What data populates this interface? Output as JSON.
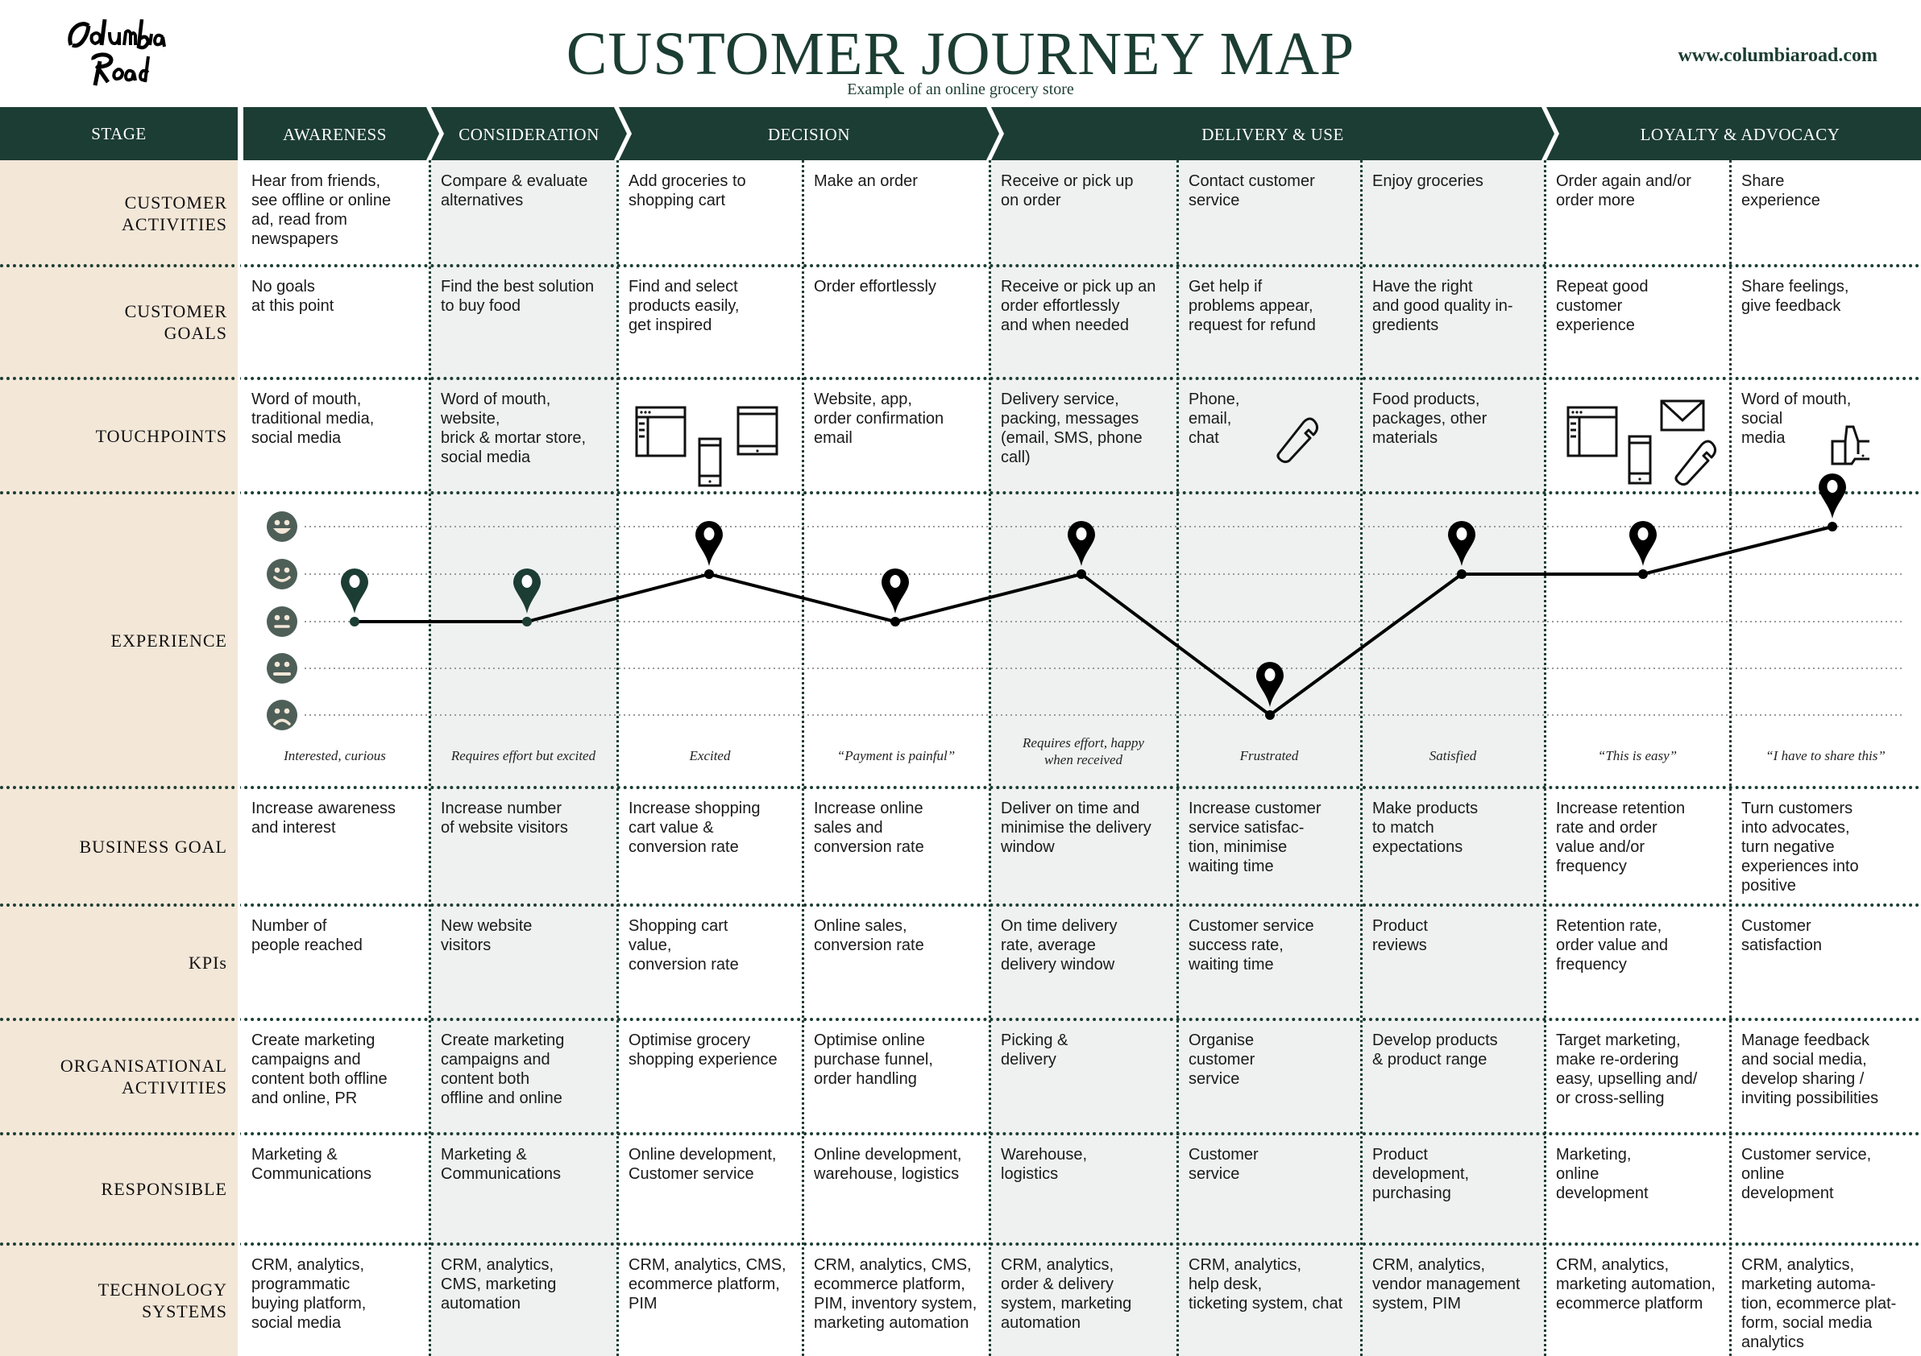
{
  "header": {
    "logo_text": "Columbia Road",
    "title": "CUSTOMER JOURNEY MAP",
    "subtitle": "Example of an online grocery store",
    "website": "www.columbiaroad.com"
  },
  "colors": {
    "brand_dark_green": "#1c3d33",
    "label_column_bg": "#f3e7d8",
    "shaded_column_bg": "#eff1f0",
    "emoji_face": "#4e5f58",
    "emoji_feature": "#f3e7d8"
  },
  "stage_label": "STAGE",
  "stages": [
    {
      "name": "AWARENESS",
      "columns": 1
    },
    {
      "name": "CONSIDERATION",
      "columns": 1
    },
    {
      "name": "DECISION",
      "columns": 2
    },
    {
      "name": "DELIVERY & USE",
      "columns": 3
    },
    {
      "name": "LOYALTY  & ADVOCACY",
      "columns": 2
    }
  ],
  "rows": [
    {
      "label": "CUSTOMER\nACTIVITIES",
      "cells": [
        "Hear from friends,\nsee offline or online\nad, read from\nnewspapers",
        "Compare & evaluate\nalternatives",
        "Add groceries to\nshopping cart",
        "Make an order",
        "Receive or pick up\non order",
        "Contact customer\nservice",
        "Enjoy groceries",
        "Order again and/or\norder more",
        "Share\nexperience"
      ]
    },
    {
      "label": "CUSTOMER\nGOALS",
      "cells": [
        "No goals\nat this point",
        "Find the best solution\nto buy food",
        "Find and select\nproducts easily,\nget inspired",
        "Order effortlessly",
        "Receive or pick up an\norder effortlessly\nand when needed",
        "Get help if\nproblems appear,\nrequest for refund",
        "Have the right\nand good quality in-\ngredients",
        "Repeat good\ncustomer\nexperience",
        "Share feelings,\ngive feedback"
      ]
    },
    {
      "label": "TOUCHPOINTS",
      "cells": [
        "Word of mouth,\ntraditional media,\nsocial media",
        "Word of mouth,\nwebsite,\nbrick & mortar store,\nsocial media",
        "",
        "Website, app,\norder confirmation\nemail",
        "Delivery service,\npacking, messages\n(email, SMS, phone\ncall)",
        "Phone,\nemail,\nchat",
        "Food products,\npackages, other\nmaterials",
        "",
        "Word of mouth,\nsocial\nmedia"
      ],
      "icons": [
        {
          "column": 2,
          "names": [
            "browser-window-icon",
            "smartphone-icon",
            "tablet-icon"
          ]
        },
        {
          "column": 5,
          "names": [
            "phone-handset-icon"
          ]
        },
        {
          "column": 7,
          "names": [
            "browser-window-icon",
            "smartphone-icon",
            "envelope-icon",
            "phone-handset-icon"
          ]
        },
        {
          "column": 8,
          "names": [
            "thumbs-up-icon"
          ]
        }
      ]
    },
    {
      "label": "EXPERIENCE",
      "type": "experience"
    },
    {
      "label": "BUSINESS GOAL",
      "cells": [
        "Increase awareness\nand interest",
        "Increase number\nof website visitors",
        "Increase shopping\ncart value &\nconversion rate",
        "Increase online\nsales and\nconversion rate",
        "Deliver on time and\nminimise the delivery\nwindow",
        "Increase customer\nservice satisfac-\ntion, minimise\nwaiting time",
        "Make products\nto match\nexpectations",
        "Increase retention\nrate and order\nvalue and/or\nfrequency",
        "Turn customers\ninto advocates,\nturn negative\nexperiences into\npositive"
      ]
    },
    {
      "label": "KPIs",
      "cells": [
        "Number of\npeople reached",
        "New website\nvisitors",
        "Shopping cart\nvalue,\nconversion rate",
        "Online sales,\nconversion rate",
        "On time delivery\nrate, average\ndelivery window",
        "Customer service\nsuccess rate,\nwaiting time",
        "Product\nreviews",
        "Retention rate,\norder value and\nfrequency",
        "Customer\nsatisfaction"
      ]
    },
    {
      "label": "ORGANISATIONAL\nACTIVITIES",
      "cells": [
        "Create marketing\ncampaigns and\ncontent both offline\nand online, PR",
        "Create marketing\ncampaigns and\ncontent both\noffline and online",
        "Optimise grocery\nshopping experience",
        "Optimise online\npurchase funnel,\norder handling",
        "Picking &\ndelivery",
        "Organise\ncustomer\nservice",
        "Develop products\n& product range",
        "Target marketing,\nmake re-ordering\neasy, upselling and/\nor cross-selling",
        "Manage feedback\nand social media,\ndevelop sharing /\ninviting possibilities"
      ]
    },
    {
      "label": "RESPONSIBLE",
      "cells": [
        "Marketing &\nCommunications",
        "Marketing &\nCommunications",
        "Online development,\nCustomer service",
        "Online development,\nwarehouse, logistics",
        "Warehouse,\nlogistics",
        "Customer\nservice",
        "Product\ndevelopment,\npurchasing",
        "Marketing,\nonline\ndevelopment",
        "Customer service,\nonline\ndevelopment"
      ]
    },
    {
      "label": "TECHNOLOGY\nSYSTEMS",
      "cells": [
        "CRM, analytics,\nprogrammatic\nbuying platform,\nsocial media",
        "CRM, analytics,\nCMS, marketing\nautomation",
        "CRM, analytics, CMS,\necommerce platform,\nPIM",
        "CRM, analytics, CMS,\necommerce platform,\nPIM, inventory system,\nmarketing automation",
        "CRM, analytics,\norder & delivery\nsystem, marketing\nautomation",
        "CRM, analytics,\nhelp desk,\nticketing system, chat",
        "CRM, analytics,\nvendor management\nsystem, PIM",
        "CRM, analytics,\nmarketing automation,\necommerce platform",
        "CRM, analytics,\nmarketing automa-\ntion, ecommerce plat-\nform, social media\nanalytics"
      ]
    }
  ],
  "experience": {
    "scale_levels": [
      "very-happy",
      "happy",
      "neutral",
      "unhappy",
      "sad"
    ],
    "scale_icons": [
      "very-happy-face-icon",
      "happy-face-icon",
      "neutral-face-icon",
      "unhappy-face-icon",
      "sad-face-icon"
    ],
    "scores": [
      3,
      3,
      4,
      3,
      4,
      1,
      4,
      4,
      5
    ],
    "score_scale": "1 = sad, 5 = very happy",
    "emotions": [
      "Interested, curious",
      "Requires effort but excited",
      "Excited",
      "“Payment is painful”",
      "Requires effort, happy\nwhen received",
      "Frustrated",
      "Satisfied",
      "“This is easy”",
      "“I have to share this”"
    ]
  },
  "shaded_columns": [
    1,
    4,
    5,
    6
  ]
}
